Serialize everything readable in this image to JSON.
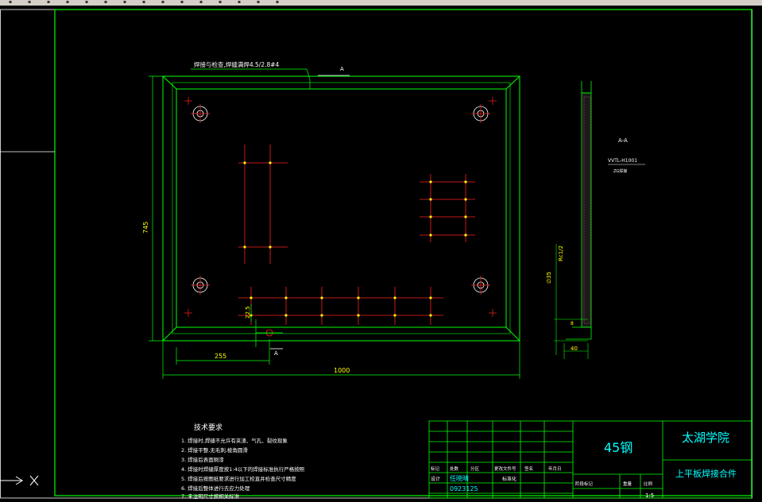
{
  "toolbar": {
    "icons": [
      "open-icon",
      "save-icon",
      "print-icon",
      "undo-icon",
      "redo-icon",
      "zoom-icon",
      "pan-icon",
      "layer-icon",
      "properties-icon",
      "match-icon",
      "dimension-icon",
      "grid-icon",
      "snap-icon",
      "ortho-icon",
      "text-icon"
    ]
  },
  "colors": {
    "background": "#000000",
    "frame": "#00ff00",
    "red_line": "#ff2020",
    "yellow_point": "#ffff00",
    "white_text": "#ffffff",
    "cyan_text": "#00ffff",
    "title_block": "#00ff00"
  },
  "drawing": {
    "leader_note": "焊接与检查,焊缝满焊4.5/2.8#4",
    "section_arrow_top": "A",
    "section_arrow_bottom": "A",
    "dim_height": "745",
    "dim_width_full": "1000",
    "dim_left_offset": "255",
    "dim_small_vertical": "22.5",
    "section_view": {
      "title": "A-A",
      "sub_label": "VVTL-H1001",
      "note": "ZG焊接"
    },
    "side_dims": {
      "rc": "Rc1/2",
      "dia": "∅35",
      "thickness": "40",
      "small": "8"
    }
  },
  "tech_requirements": {
    "heading": "技术要求",
    "items": [
      "1. 焊接时,焊缝不允许有夹渣、气孔、裂纹现象",
      "2. 焊接平整,无毛刺,棱角圆滑",
      "3. 焊接后表面刷漆",
      "4. 焊接时焊缝厚度按1:4以下的焊接标准执行严格按照",
      "5. 焊接后按图纸要求进行加工校直并检查尺寸精度",
      "6. 焊接后整体进行去应力处理",
      "7. 未注明尺寸按相关标准"
    ]
  },
  "title_block": {
    "material": "45钢",
    "school": "太湖学院",
    "part_name": "上平板焊接合件",
    "row_labels_1": [
      "标记",
      "处数",
      "分区",
      "更改文件号",
      "签名",
      "年月日"
    ],
    "row_labels_2": [
      "设计",
      "任晓晴",
      "",
      "标准化"
    ],
    "student_id": "0923125",
    "stage_labels": [
      "阶段标记",
      "重量",
      "比例"
    ],
    "scale": "1:5"
  }
}
